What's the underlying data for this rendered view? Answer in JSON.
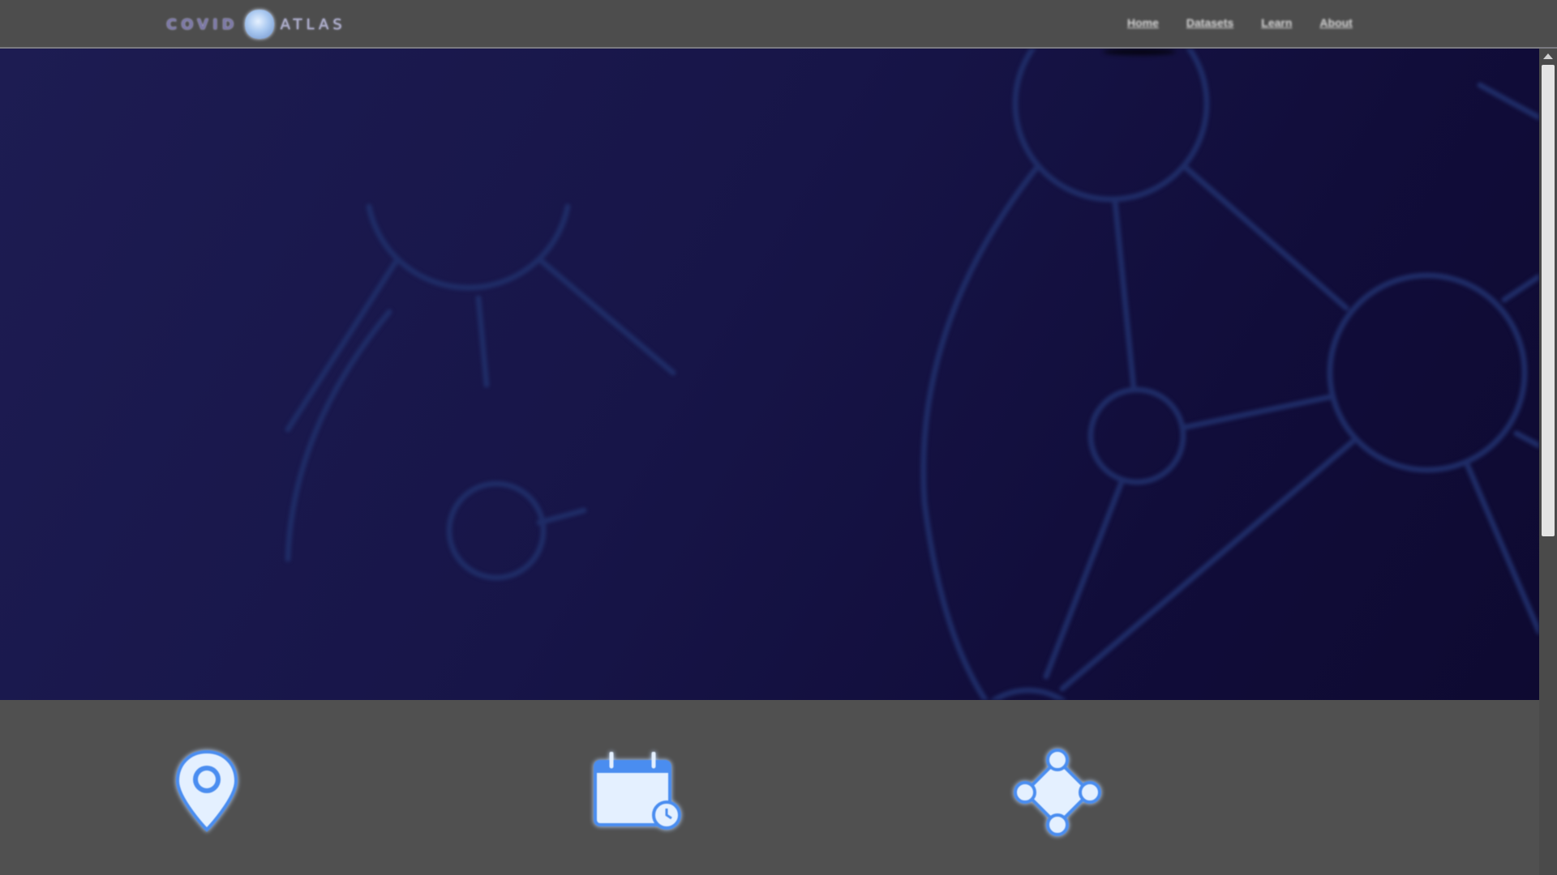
{
  "app": {
    "logo": {
      "word_left": "COVID",
      "word_right": "ATLAS",
      "globe_icon": "globe-icon"
    },
    "nav": [
      {
        "label": "Home"
      },
      {
        "label": "Datasets"
      },
      {
        "label": "Learn"
      },
      {
        "label": "About"
      }
    ]
  },
  "hero": {
    "background_colors": [
      "#1d1c52",
      "#0e0a31"
    ],
    "pattern_icon": "molecule-network-icon",
    "pattern_color": "#1f2c66"
  },
  "features": [
    {
      "icon": "map-pin-icon",
      "label": ""
    },
    {
      "icon": "calendar-clock-icon",
      "label": ""
    },
    {
      "icon": "network-nodes-icon",
      "label": ""
    }
  ],
  "colors": {
    "accent": "#4a8df0",
    "accent_light": "#e4f0ff",
    "header_bg": "#4d4d4d",
    "page_bg": "#505050"
  }
}
